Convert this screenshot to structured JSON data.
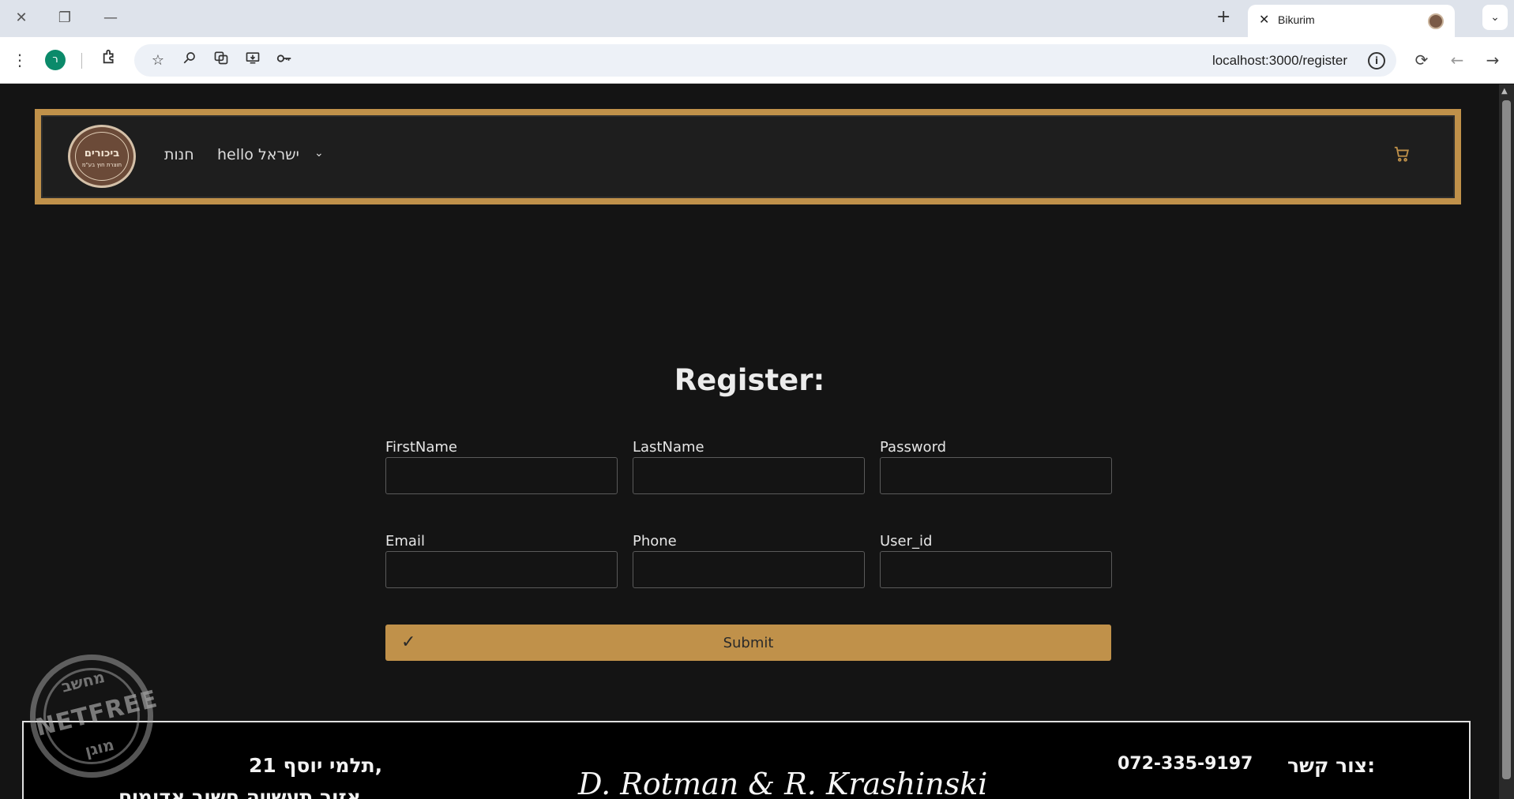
{
  "browser": {
    "tab_title": "Bikurim",
    "new_tab_label": "+",
    "url": "localhost:3000/register",
    "profile_initial": "ר"
  },
  "navbar": {
    "logo_title": "ביכורים",
    "logo_subtitle": "תוצרת חוץ בע\"מ",
    "shop_label": "חנות",
    "user_menu_label": "hello ישראל"
  },
  "form": {
    "title": "Register:",
    "fields": [
      {
        "label": "FirstName",
        "value": ""
      },
      {
        "label": "LastName",
        "value": ""
      },
      {
        "label": "Password",
        "value": ""
      },
      {
        "label": "Email",
        "value": ""
      },
      {
        "label": "Phone",
        "value": ""
      },
      {
        "label": "User_id",
        "value": ""
      }
    ],
    "submit_label": "Submit"
  },
  "footer": {
    "address_line1": "תלמי יוסף 21,",
    "address_line2": "אזור תעשייה חשוב אדומים",
    "signature": "D. Rotman & R. Krashinski",
    "contact_label": "צור קשר:",
    "phone": "072-335-9197"
  },
  "watermark": {
    "top": "מחשב",
    "middle": "NETFREE",
    "bottom": "מוגן"
  },
  "colors": {
    "accent": "#c0914a",
    "background": "#141414",
    "navbar_bg": "#1e1e1e"
  }
}
